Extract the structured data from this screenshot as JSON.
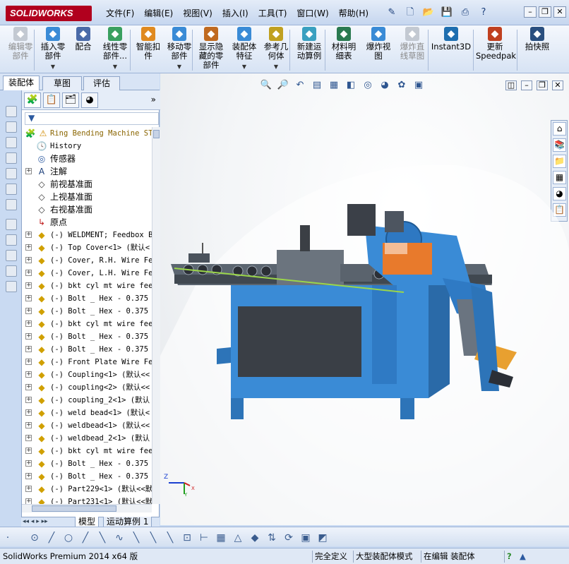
{
  "app": {
    "logo": "SOLIDWORKS"
  },
  "menu": [
    "文件(F)",
    "编辑(E)",
    "视图(V)",
    "插入(I)",
    "工具(T)",
    "窗口(W)",
    "帮助(H)"
  ],
  "ribbon": [
    {
      "label1": "编辑零",
      "label2": "部件",
      "icon": "edit-component-icon",
      "disabled": true
    },
    {
      "label1": "插入零",
      "label2": "部件",
      "icon": "insert-component-icon",
      "dropdown": true
    },
    {
      "label1": "配合",
      "label2": "",
      "icon": "mate-icon"
    },
    {
      "label1": "线性零",
      "label2": "部件...",
      "icon": "linear-pattern-icon",
      "dropdown": true
    },
    {
      "label1": "智能扣",
      "label2": "件",
      "icon": "smart-fastener-icon"
    },
    {
      "label1": "移动零",
      "label2": "部件",
      "icon": "move-component-icon",
      "dropdown": true
    },
    {
      "label1": "显示隐",
      "label2": "藏的零",
      "label3": "部件",
      "icon": "show-hidden-icon"
    },
    {
      "label1": "装配体",
      "label2": "特征",
      "icon": "assembly-feature-icon",
      "dropdown": true
    },
    {
      "label1": "参考几",
      "label2": "何体",
      "icon": "reference-geometry-icon",
      "dropdown": true
    },
    {
      "label1": "新建运",
      "label2": "动算例",
      "icon": "motion-study-icon"
    },
    {
      "label1": "材料明",
      "label2": "细表",
      "icon": "bom-icon"
    },
    {
      "label1": "爆炸视",
      "label2": "图",
      "icon": "exploded-view-icon"
    },
    {
      "label1": "爆炸直",
      "label2": "线草图",
      "icon": "explode-line-sketch-icon",
      "disabled": true
    },
    {
      "label1": "Instant3D",
      "label2": "",
      "icon": "instant3d-icon"
    },
    {
      "label1": "更新",
      "label2": "Speedpak",
      "icon": "speedpak-icon"
    },
    {
      "label1": "拍快照",
      "label2": "",
      "icon": "snapshot-icon"
    }
  ],
  "cmd_tabs": [
    "装配体",
    "草图",
    "评估"
  ],
  "tree": {
    "root": "Ring Bending Machine STl",
    "items": [
      {
        "text": "History",
        "icon": "history-icon",
        "plus": false
      },
      {
        "text": "传感器",
        "icon": "sensor-icon",
        "plus": false
      },
      {
        "text": "注解",
        "icon": "annotation-icon",
        "plus": true
      },
      {
        "text": "前视基准面",
        "icon": "plane-icon",
        "plus": false
      },
      {
        "text": "上视基准面",
        "icon": "plane-icon",
        "plus": false
      },
      {
        "text": "右视基准面",
        "icon": "plane-icon",
        "plus": false
      },
      {
        "text": "原点",
        "icon": "origin-icon",
        "plus": false
      },
      {
        "text": "(-) WELDMENT; Feedbox B",
        "icon": "part-icon",
        "plus": true
      },
      {
        "text": "(-) Top Cover<1> (默认<",
        "icon": "part-icon",
        "plus": true
      },
      {
        "text": "(-) Cover, R.H. Wire Fe",
        "icon": "part-icon",
        "plus": true
      },
      {
        "text": "(-) Cover, L.H. Wire Fe",
        "icon": "part-icon",
        "plus": true
      },
      {
        "text": "(-) bkt cyl mt wire fee",
        "icon": "part-icon",
        "plus": true
      },
      {
        "text": "(-) Bolt _ Hex - 0.375",
        "icon": "part-icon",
        "plus": true
      },
      {
        "text": "(-) Bolt _ Hex - 0.375",
        "icon": "part-icon",
        "plus": true
      },
      {
        "text": "(-) bkt cyl mt wire fee",
        "icon": "part-icon",
        "plus": true
      },
      {
        "text": "(-) Bolt _ Hex - 0.375",
        "icon": "part-icon",
        "plus": true
      },
      {
        "text": "(-) Bolt _ Hex - 0.375",
        "icon": "part-icon",
        "plus": true
      },
      {
        "text": "(-) Front Plate Wire Fe",
        "icon": "part-icon",
        "plus": true
      },
      {
        "text": "(-) Coupling<1> (默认<<",
        "icon": "part-icon",
        "plus": true
      },
      {
        "text": "(-) coupling<2> (默认<<",
        "icon": "part-icon",
        "plus": true
      },
      {
        "text": "(-) coupling_2<1> (默认",
        "icon": "part-icon",
        "plus": true
      },
      {
        "text": "(-) weld bead<1> (默认<",
        "icon": "part-icon",
        "plus": true
      },
      {
        "text": "(-) weldbead<1> (默认<<",
        "icon": "part-icon",
        "plus": true
      },
      {
        "text": "(-) weldbead_2<1> (默认",
        "icon": "part-icon",
        "plus": true
      },
      {
        "text": "(-) bkt cyl mt wire fee",
        "icon": "part-icon",
        "plus": true
      },
      {
        "text": "(-) Bolt _ Hex - 0.375",
        "icon": "part-icon",
        "plus": true
      },
      {
        "text": "(-) Bolt _ Hex - 0.375",
        "icon": "part-icon",
        "plus": true
      },
      {
        "text": "(-) Part229<1> (默认<<默",
        "icon": "part-icon",
        "plus": true
      },
      {
        "text": "(-) Part231<1> (默认<<默",
        "icon": "part-icon",
        "plus": true
      }
    ]
  },
  "bottom_tabs": [
    "模型",
    "运动算例 1"
  ],
  "triad": {
    "x": "X",
    "y": "Y",
    "z": "Z"
  },
  "status": {
    "app": "SolidWorks Premium 2014 x64 版",
    "defined": "完全定义",
    "mode": "大型装配体模式",
    "editing": "在编辑 装配体"
  },
  "colors": {
    "machine_blue": "#3a8bd6",
    "accent_orange": "#e87a2c",
    "logo_red": "#b1001e"
  }
}
